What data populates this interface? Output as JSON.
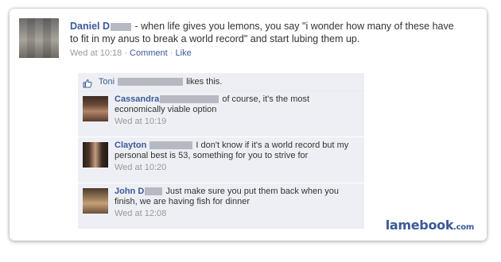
{
  "post": {
    "author_name": "Daniel D",
    "text": "- when life gives you lemons, you say \"i wonder how many of these have to fit in my anus to break a world record\" and start lubing them up.",
    "timestamp": "Wed at 10:18",
    "separator": "·",
    "comment_link": "Comment",
    "like_link": "Like"
  },
  "likes_bar": {
    "liker_name": "Toni",
    "text": "likes this."
  },
  "comments": [
    {
      "author": "Cassandra",
      "text": "of course, it's the most economically viable option",
      "time": "Wed at 10:19"
    },
    {
      "author": "Clayton",
      "text": "I don't know if it's a world record but my personal best is 53, something for you to strive for",
      "time": "Wed at 10:20"
    },
    {
      "author": "John D",
      "text": "Just make sure you put them back when you finish, we are having fish for dinner",
      "time": "Wed at 12:08"
    }
  ],
  "watermark": {
    "name": "lamebook",
    "tld": ".com"
  },
  "colors": {
    "link_blue": "#3b5998",
    "comment_bg": "#edeff4",
    "meta_grey": "#999999"
  }
}
